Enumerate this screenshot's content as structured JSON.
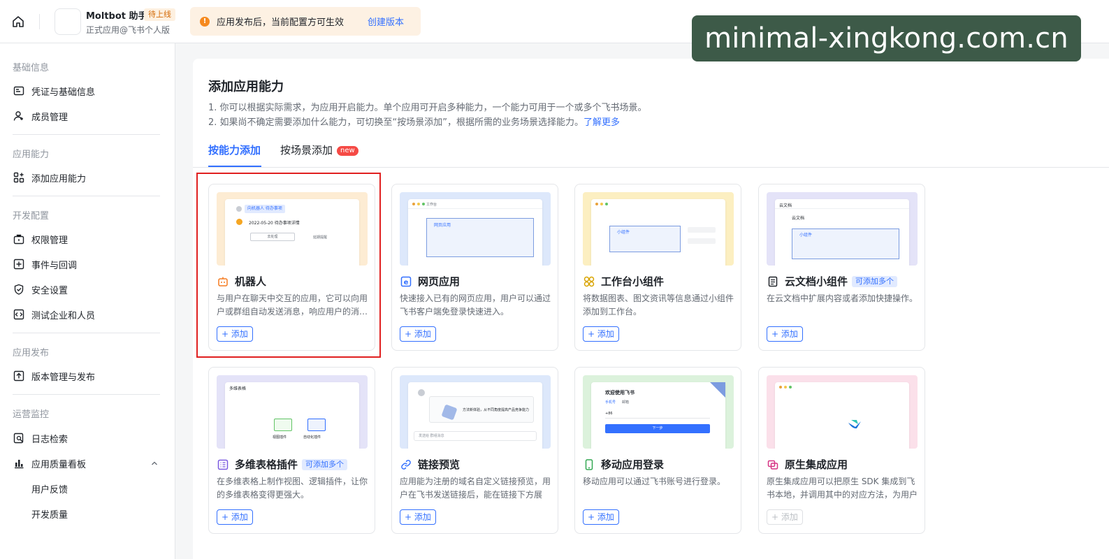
{
  "header": {
    "app_name": "Moltbot 助手",
    "app_badge": "待上线",
    "app_subtitle": "正式应用@飞书个人版",
    "notice_text": "应用发布后，当前配置方可生效",
    "notice_link": "创建版本"
  },
  "sidebar": {
    "groups": {
      "basic": "基础信息",
      "capability": "应用能力",
      "dev": "开发配置",
      "publish": "应用发布",
      "ops": "运营监控"
    },
    "items": {
      "credentials": "凭证与基础信息",
      "members": "成员管理",
      "add_capability": "添加应用能力",
      "permissions": "权限管理",
      "events": "事件与回调",
      "security": "安全设置",
      "test_org": "测试企业和人员",
      "versions": "版本管理与发布",
      "logs": "日志检索",
      "quality": "应用质量看板",
      "feedback": "用户反馈",
      "dev_quality": "开发质量"
    }
  },
  "main": {
    "title": "添加应用能力",
    "desc1": "1. 你可以根据实际需求，为应用开启能力。单个应用可开启多种能力，一个能力可用于一个或多个飞书场景。",
    "desc2": "2. 如果尚不确定需要添加什么能力，可切换至“按场景添加”，根据所需的业务场景选择能力。",
    "desc_link": "了解更多",
    "tabs": {
      "by_capability": "按能力添加",
      "by_scene": "按场景添加",
      "new_badge": "new"
    },
    "add_label": "+ 添加",
    "cards": {
      "bot": {
        "title": "机器人",
        "desc": "与用户在聊天中交互的应用，它可以向用户或群组自动发送消息，响应用户的消…",
        "preview": {
          "tag": "向机器人 待办事项",
          "line": "2022-05-20 待办事项详情",
          "btn1": "去处理",
          "btn2": "延期提醒"
        }
      },
      "web": {
        "title": "网页应用",
        "desc": "快速接入已有的网页应用，用户可以通过飞书客户端免登录快速进入。",
        "preview": {
          "tab": "工作台",
          "box": "网页应用"
        }
      },
      "widget": {
        "title": "工作台小组件",
        "desc": "将数据图表、图文资讯等信息通过小组件添加到工作台。",
        "preview": {
          "box": "小组件"
        }
      },
      "doc_widget": {
        "title": "云文档小组件",
        "tag": "可添加多个",
        "desc": "在云文档中扩展内容或者添加快捷操作。",
        "preview": {
          "crumb": "云文档",
          "heading": "云文档",
          "box": "小组件"
        }
      },
      "base_plugin": {
        "title": "多维表格插件",
        "tag": "可添加多个",
        "desc": "在多维表格上制作视图、逻辑插件，让你的多维表格变得更强大。",
        "preview": {
          "crumb": "多维表格",
          "p1": "视图插件",
          "p2": "自动化插件"
        }
      },
      "link_preview": {
        "title": "链接预览",
        "desc": "应用能为注册的域名自定义链接预览，用户在飞书发送链接后，能在链接下方展示…",
        "preview": {
          "msg": "方法新体验，从不同角度提高产品竞争能力",
          "input": "发送给 群组消息"
        }
      },
      "mobile_login": {
        "title": "移动应用登录",
        "desc": "移动应用可以通过飞书账号进行登录。",
        "preview": {
          "welcome": "欢迎使用飞书",
          "tab1": "手机号",
          "tab2": "邮箱",
          "code": "+86",
          "next": "下一步"
        }
      },
      "native": {
        "title": "原生集成应用",
        "desc": "原生集成应用可以把原生 SDK 集成到飞书本地，并调用其中的对应方法，为用户提…"
      }
    }
  },
  "watermark": "minimal-xingkong.com.cn",
  "colors": {
    "accent": "#3370ff",
    "highlight": "#e02020",
    "watermark_bg": "#3d5a48"
  }
}
